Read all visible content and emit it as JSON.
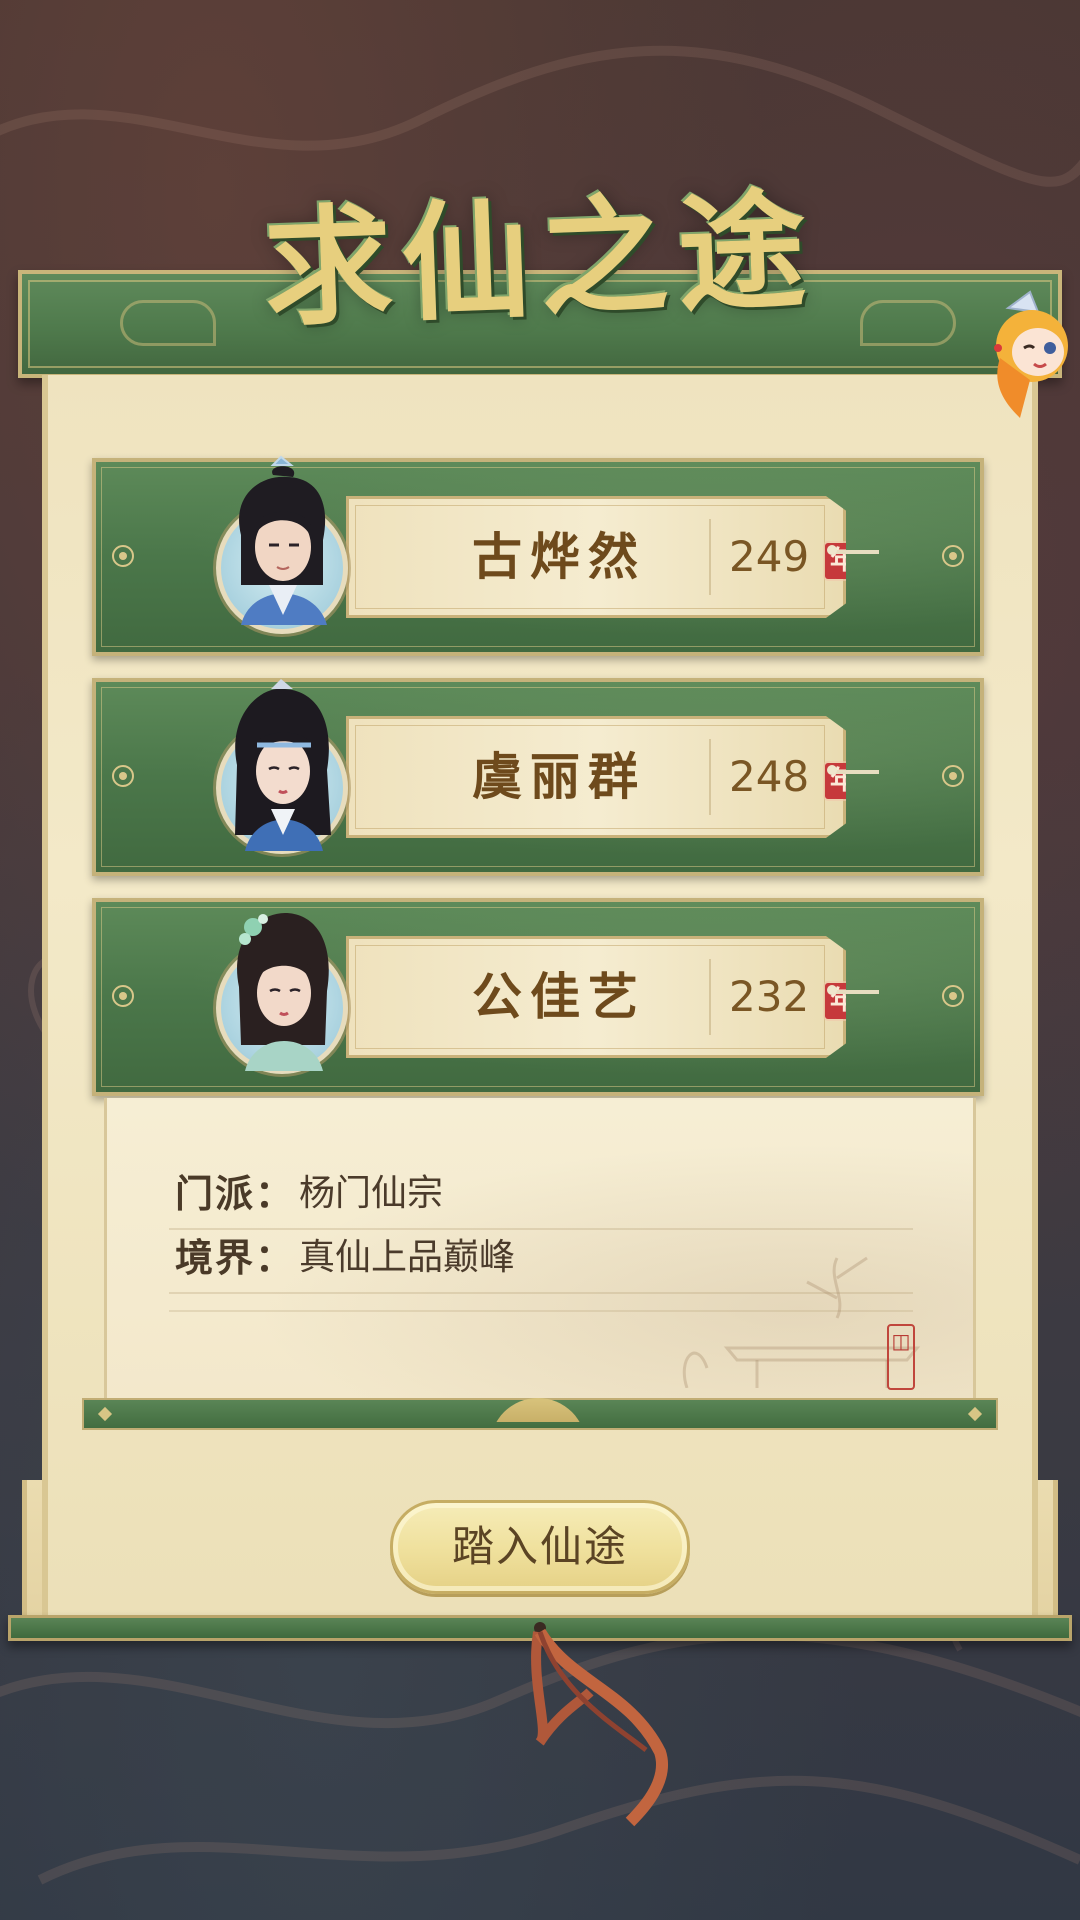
{
  "title": "求仙之途",
  "characters": [
    {
      "name": "古烨然",
      "age": "249",
      "age_unit": "年"
    },
    {
      "name": "虞丽群",
      "age": "248",
      "age_unit": "年"
    },
    {
      "name": "公佳艺",
      "age": "232",
      "age_unit": "年"
    }
  ],
  "info": {
    "sect_label": "门派：",
    "sect_value": "杨门仙宗",
    "realm_label": "境界：",
    "realm_value": "真仙上品巅峰"
  },
  "enter_button_label": "踏入仙途",
  "colors": {
    "panel_green": "#4b774a",
    "gold_border": "#c5b27a",
    "paper": "#f3e9c8",
    "text_brown": "#6e4a1c",
    "year_badge_red": "#c6393b",
    "button_fill": "#efe09c"
  }
}
